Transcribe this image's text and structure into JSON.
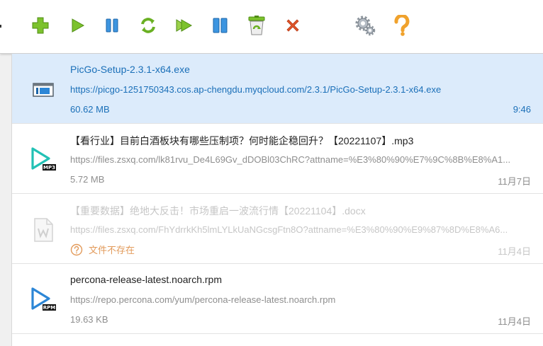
{
  "toolbar": {
    "buttons": [
      {
        "name": "add-task-button",
        "icon": "plus-icon"
      },
      {
        "name": "start-button",
        "icon": "play-icon"
      },
      {
        "name": "pause-button",
        "icon": "pause-icon"
      },
      {
        "name": "refresh-button",
        "icon": "refresh-icon"
      },
      {
        "name": "start-all-button",
        "icon": "double-play-icon"
      },
      {
        "name": "pause-all-button",
        "icon": "double-pause-icon"
      },
      {
        "name": "recycle-bin-button",
        "icon": "recycle-bin-icon"
      },
      {
        "name": "delete-button",
        "icon": "x-icon"
      },
      {
        "name": "settings-button",
        "icon": "gears-icon"
      },
      {
        "name": "help-button",
        "icon": "question-icon"
      }
    ]
  },
  "downloads": [
    {
      "name": "PicGo-Setup-2.3.1-x64.exe",
      "url": "https://picgo-1251750343.cos.ap-chengdu.myqcloud.com/2.3.1/PicGo-Setup-2.3.1-x64.exe",
      "size": "60.62 MB",
      "time": "9:46",
      "icon": "exe-file-icon",
      "selected": true
    },
    {
      "name": "【看行业】目前白酒板块有哪些压制项？何时能企稳回升？【20221107】.mp3",
      "url": "https://files.zsxq.com/lk81rvu_De4L69Gv_dDOBl03ChRC?attname=%E3%80%90%E7%9C%8B%E8%A1...",
      "size": "5.72 MB",
      "time": "11月7日",
      "icon": "mp3-file-icon",
      "icon_label": "MP3"
    },
    {
      "name": "【重要数据】绝地大反击！市场重启一波流行情【20221104】.docx",
      "url": "https://files.zsxq.com/FhYdrrkKh5lmLYLkUaNGcsgFtn8O?attname=%E3%80%90%E9%87%8D%E8%A6...",
      "status": "文件不存在",
      "time": "11月4日",
      "icon": "docx-file-icon",
      "missing": true
    },
    {
      "name": "percona-release-latest.noarch.rpm",
      "url": "https://repo.percona.com/yum/percona-release-latest.noarch.rpm",
      "size": "19.63 KB",
      "time": "11月4日",
      "icon": "rpm-file-icon",
      "icon_label": "RPM"
    }
  ],
  "colors": {
    "accent": "#1a6fb8",
    "selected_bg": "#dcebfb",
    "error": "#e29a5a",
    "green": "#6ab023",
    "blue": "#2c86d6",
    "red": "#e0552b",
    "gold": "#f0a22c"
  }
}
